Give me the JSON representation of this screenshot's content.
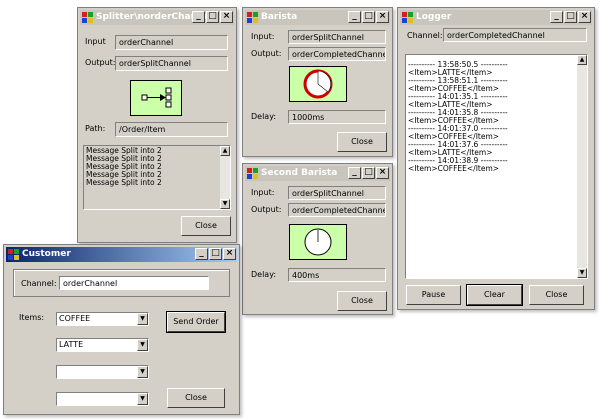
{
  "colors": {
    "picture_bg": "#ccffaa",
    "title_active": "#0a246a",
    "clock_ring": "#cc0000"
  },
  "splitter": {
    "title": "Splitter\\norderChannel",
    "input_label": "Input",
    "input_value": "orderChannel",
    "output_label": "Output:",
    "output_value": "orderSplitChannel",
    "path_label": "Path:",
    "path_value": "/Order/Item",
    "log": [
      "Message Split into 2",
      "Message Split into 2",
      "Message Split into 2",
      "Message Split into 2",
      "Message Split into 2"
    ],
    "close_label": "Close"
  },
  "barista": {
    "title": "Barista",
    "input_label": "Input:",
    "input_value": "orderSplitChannel",
    "output_label": "Output:",
    "output_value": "orderCompletedChannel",
    "delay_label": "Delay:",
    "delay_value": "1000ms",
    "close_label": "Close"
  },
  "second_barista": {
    "title": "Second Barista",
    "input_label": "Input:",
    "input_value": "orderSplitChannel",
    "output_label": "Output:",
    "output_value": "orderCompletedChannel",
    "delay_label": "Delay:",
    "delay_value": "400ms",
    "close_label": "Close"
  },
  "logger": {
    "title": "Logger",
    "channel_label": "Channel:",
    "channel_value": "orderCompletedChannel",
    "log": [
      "---------- 13:58:50.5 ----------",
      "<Item>LATTE</Item>",
      "---------- 13:58:51.1 ----------",
      "<Item>COFFEE</Item>",
      "---------- 14:01:35.1 ----------",
      "<Item>LATTE</Item>",
      "---------- 14:01:35.8 ----------",
      "<Item>COFFEE</Item>",
      "---------- 14:01:37.0 ----------",
      "<Item>COFFEE</Item>",
      "---------- 14:01:37.6 ----------",
      "<Item>LATTE</Item>",
      "---------- 14:01:38.9 ----------",
      "<Item>COFFEE</Item>"
    ],
    "pause_label": "Pause",
    "clear_label": "Clear",
    "close_label": "Close"
  },
  "customer": {
    "title": "Customer",
    "channel_label": "Channel:",
    "channel_value": "orderChannel",
    "items_label": "Items:",
    "items": [
      "COFFEE",
      "LATTE",
      "",
      ""
    ],
    "send_label": "Send Order",
    "close_label": "Close"
  }
}
